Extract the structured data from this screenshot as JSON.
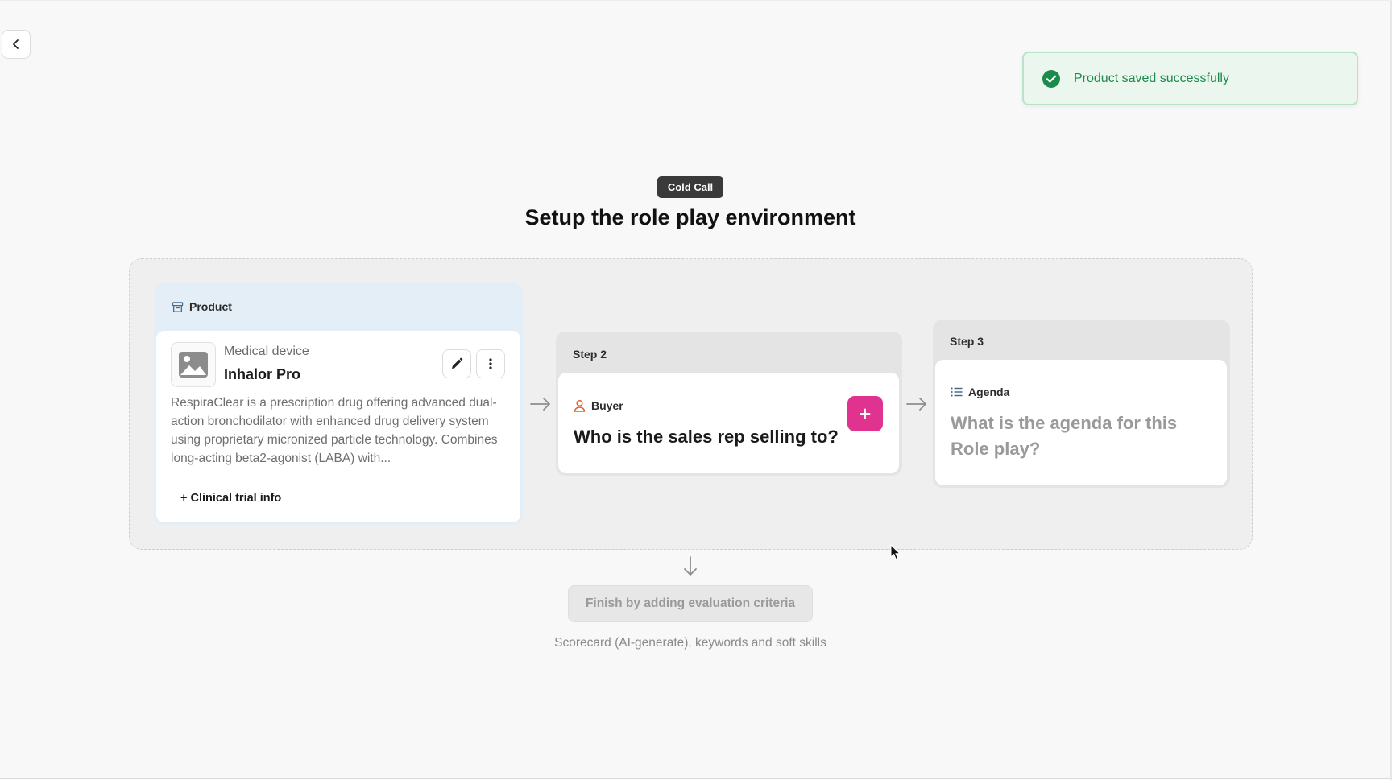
{
  "header": {
    "back_icon": "chevron-left-icon"
  },
  "toast": {
    "message": "Product saved successfully",
    "icon": "check-circle-icon",
    "color": "#1b8a4b"
  },
  "mode_badge": "Cold Call",
  "page_title": "Setup the role play environment",
  "product": {
    "section_label": "Product",
    "section_icon": "box-icon",
    "category": "Medical device",
    "name": "Inhalor Pro",
    "image_icon": "image-placeholder-icon",
    "description": "RespiraClear is a prescription drug offering advanced dual-action bronchodilator with enhanced drug delivery system using proprietary micronized particle technology. Combines long-acting beta2-agonist (LABA) with...",
    "add_link": "+ Clinical trial info"
  },
  "step2": {
    "label": "Step 2",
    "tag": "Buyer",
    "tag_icon": "person-icon",
    "question": "Who is the sales rep selling to?",
    "add_label": "+",
    "accent": "#e0338f"
  },
  "step3": {
    "label": "Step 3",
    "tag": "Agenda",
    "tag_icon": "list-icon",
    "question": "What is the agenda for this Role play?"
  },
  "finish": {
    "button_label": "Finish by adding evaluation criteria",
    "subtitle": "Scorecard (AI-generate), keywords and soft skills"
  }
}
